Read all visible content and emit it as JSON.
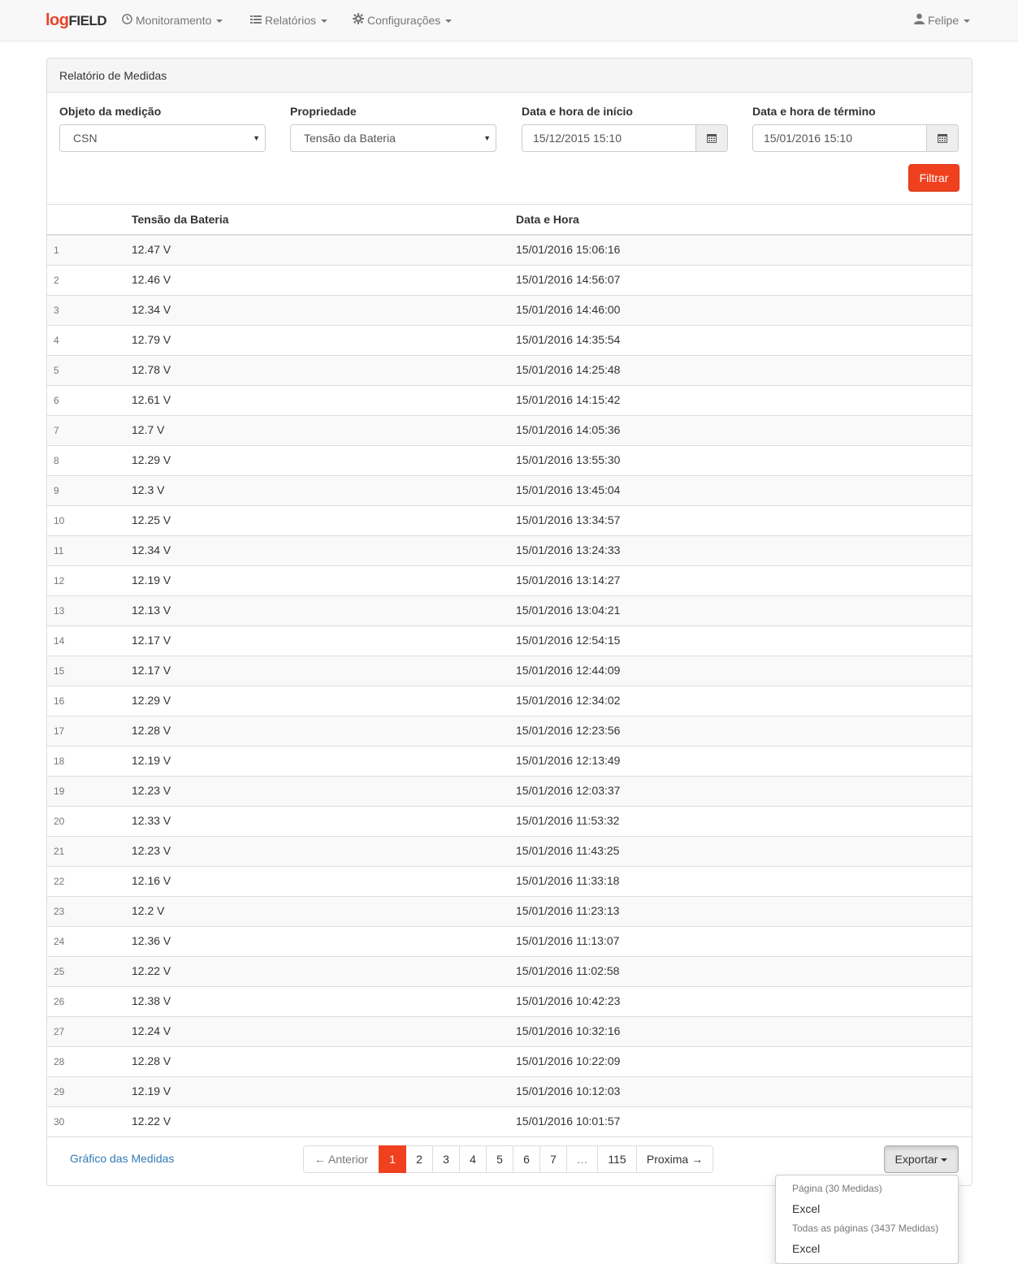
{
  "navbar": {
    "brand_log": "log",
    "brand_field": "FIELD",
    "menu": [
      {
        "label": "Monitoramento",
        "icon": "dashboard-icon"
      },
      {
        "label": "Relatórios",
        "icon": "list-icon"
      },
      {
        "label": "Configurações",
        "icon": "gear-icon"
      }
    ],
    "user": "Felipe"
  },
  "panel": {
    "title": "Relatório de Medidas"
  },
  "filters": {
    "objeto_label": "Objeto da medição",
    "objeto_value": "CSN",
    "propriedade_label": "Propriedade",
    "propriedade_value": "Tensão da Bateria",
    "inicio_label": "Data e hora de início",
    "inicio_value": "15/12/2015 15:10",
    "termino_label": "Data e hora de término",
    "termino_value": "15/01/2016 15:10",
    "filtrar_label": "Filtrar"
  },
  "table": {
    "col_value": "Tensão da Bateria",
    "col_date": "Data e Hora",
    "rows": [
      {
        "n": "1",
        "v": "12.47 V",
        "d": "15/01/2016 15:06:16"
      },
      {
        "n": "2",
        "v": "12.46 V",
        "d": "15/01/2016 14:56:07"
      },
      {
        "n": "3",
        "v": "12.34 V",
        "d": "15/01/2016 14:46:00"
      },
      {
        "n": "4",
        "v": "12.79 V",
        "d": "15/01/2016 14:35:54"
      },
      {
        "n": "5",
        "v": "12.78 V",
        "d": "15/01/2016 14:25:48"
      },
      {
        "n": "6",
        "v": "12.61 V",
        "d": "15/01/2016 14:15:42"
      },
      {
        "n": "7",
        "v": "12.7 V",
        "d": "15/01/2016 14:05:36"
      },
      {
        "n": "8",
        "v": "12.29 V",
        "d": "15/01/2016 13:55:30"
      },
      {
        "n": "9",
        "v": "12.3 V",
        "d": "15/01/2016 13:45:04"
      },
      {
        "n": "10",
        "v": "12.25 V",
        "d": "15/01/2016 13:34:57"
      },
      {
        "n": "11",
        "v": "12.34 V",
        "d": "15/01/2016 13:24:33"
      },
      {
        "n": "12",
        "v": "12.19 V",
        "d": "15/01/2016 13:14:27"
      },
      {
        "n": "13",
        "v": "12.13 V",
        "d": "15/01/2016 13:04:21"
      },
      {
        "n": "14",
        "v": "12.17 V",
        "d": "15/01/2016 12:54:15"
      },
      {
        "n": "15",
        "v": "12.17 V",
        "d": "15/01/2016 12:44:09"
      },
      {
        "n": "16",
        "v": "12.29 V",
        "d": "15/01/2016 12:34:02"
      },
      {
        "n": "17",
        "v": "12.28 V",
        "d": "15/01/2016 12:23:56"
      },
      {
        "n": "18",
        "v": "12.19 V",
        "d": "15/01/2016 12:13:49"
      },
      {
        "n": "19",
        "v": "12.23 V",
        "d": "15/01/2016 12:03:37"
      },
      {
        "n": "20",
        "v": "12.33 V",
        "d": "15/01/2016 11:53:32"
      },
      {
        "n": "21",
        "v": "12.23 V",
        "d": "15/01/2016 11:43:25"
      },
      {
        "n": "22",
        "v": "12.16 V",
        "d": "15/01/2016 11:33:18"
      },
      {
        "n": "23",
        "v": "12.2 V",
        "d": "15/01/2016 11:23:13"
      },
      {
        "n": "24",
        "v": "12.36 V",
        "d": "15/01/2016 11:13:07"
      },
      {
        "n": "25",
        "v": "12.22 V",
        "d": "15/01/2016 11:02:58"
      },
      {
        "n": "26",
        "v": "12.38 V",
        "d": "15/01/2016 10:42:23"
      },
      {
        "n": "27",
        "v": "12.24 V",
        "d": "15/01/2016 10:32:16"
      },
      {
        "n": "28",
        "v": "12.28 V",
        "d": "15/01/2016 10:22:09"
      },
      {
        "n": "29",
        "v": "12.19 V",
        "d": "15/01/2016 10:12:03"
      },
      {
        "n": "30",
        "v": "12.22 V",
        "d": "15/01/2016 10:01:57"
      }
    ]
  },
  "footer": {
    "chart_link": "Gráfico das Medidas",
    "pagination": {
      "prev": "← Anterior",
      "pages": [
        "1",
        "2",
        "3",
        "4",
        "5",
        "6",
        "7",
        "…",
        "115"
      ],
      "active": "1",
      "next": "Proxima →"
    },
    "export_label": "Exportar",
    "export_menu": {
      "header_page": "Página (30 Medidas)",
      "item_page": "Excel",
      "header_all": "Todas as páginas (3437 Medidas)",
      "item_all": "Excel"
    }
  },
  "colors": {
    "accent": "#f0411e",
    "link": "#337ab7"
  }
}
